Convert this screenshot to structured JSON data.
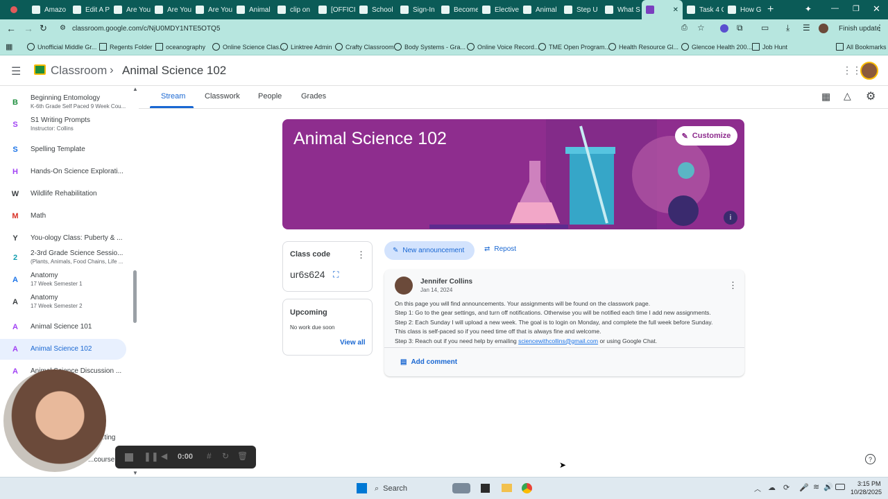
{
  "browser": {
    "tabs": [
      "Amazo",
      "Edit A P",
      "Are You",
      "Are You",
      "Are You",
      "Animal",
      "clip on",
      "[OFFICI",
      "School",
      "Sign-In",
      "Become",
      "Elective",
      "Animal",
      "Step U",
      "What S",
      "",
      "Task 4 C",
      "How G"
    ],
    "url": "classroom.google.com/c/NjU0MDY1NTE5OTQ5",
    "finish_update": "Finish update",
    "bookmarks": [
      "Unofficial Middle Gr...",
      "Regents Folder",
      "oceanography",
      "Online Science Clas...",
      "Linktree Admin",
      "Crafty Classroom",
      "Body Systems - Gra...",
      "Online Voice Record...",
      "TME Open Program...",
      "Health Resource Gl...",
      "Glencoe Health 200...",
      "Job Hunt",
      "All Bookmarks"
    ]
  },
  "app": {
    "brand": "Classroom",
    "breadcrumb_sep": "›",
    "course_title": "Animal Science 102"
  },
  "tabs": [
    "Stream",
    "Classwork",
    "People",
    "Grades"
  ],
  "sidebar": [
    {
      "letter": "B",
      "name": "Beginning Entomology",
      "sub": "K-6th Grade Self Paced 9 Week Cou...",
      "color": "#1e8e3e"
    },
    {
      "letter": "S",
      "name": "S1 Writing Prompts",
      "sub": "Instructor: Collins",
      "color": "#a142f4"
    },
    {
      "letter": "S",
      "name": "Spelling Template",
      "sub": "",
      "color": "#1a73e8"
    },
    {
      "letter": "H",
      "name": "Hands-On Science Explorati...",
      "sub": "",
      "color": "#a142f4"
    },
    {
      "letter": "W",
      "name": "Wildlife Rehabilitation",
      "sub": "",
      "color": "#3c4043"
    },
    {
      "letter": "M",
      "name": "Math",
      "sub": "",
      "color": "#d93025"
    },
    {
      "letter": "Y",
      "name": "You-ology Class: Puberty & ...",
      "sub": "",
      "color": "#3c4043"
    },
    {
      "letter": "2",
      "name": "2-3rd Grade Science Sessio...",
      "sub": "(Plants, Animals, Food Chains, Life ...",
      "color": "#129eaf"
    },
    {
      "letter": "A",
      "name": "Anatomy",
      "sub": "17 Week Semester 1",
      "color": "#1a73e8"
    },
    {
      "letter": "A",
      "name": "Anatomy",
      "sub": "17 Week Semester 2",
      "color": "#3c4043"
    },
    {
      "letter": "A",
      "name": "Animal Science 101",
      "sub": "",
      "color": "#a142f4"
    },
    {
      "letter": "A",
      "name": "Animal Science 102",
      "sub": "",
      "color": "#a142f4"
    },
    {
      "letter": "A",
      "name": "Animal Science Discussion ...",
      "sub": "",
      "color": "#a142f4"
    }
  ],
  "sidebar_partial": [
    "...ting",
    "...course"
  ],
  "banner": {
    "title": "Animal Science 102",
    "customize": "Customize"
  },
  "class_code": {
    "label": "Class code",
    "code": "ur6s624"
  },
  "upcoming": {
    "title": "Upcoming",
    "text": "No work due soon",
    "link": "View all"
  },
  "actions": {
    "new_announcement": "New announcement",
    "repost": "Repost"
  },
  "post": {
    "author": "Jennifer Collins",
    "date": "Jan 14, 2024",
    "lines": [
      "On this page you will find announcements. Your assignments will be found on the classwork page.",
      "Step 1: Go to the gear settings, and turn off notifications. Otherwise you will be notified each time I add new assignments.",
      "Step 2: Each Sunday I will upload a new week. The goal is to login on Monday, and complete the full week before Sunday.",
      "This class is self-paced so if you need time off that is always fine and welcome."
    ],
    "line5_pre": "Step 3: Reach out if you need help by emailing ",
    "email": "sciencewithcollins@gmail.com",
    "line5_post": " or using Google Chat.",
    "add_comment": "Add comment"
  },
  "recorder": {
    "time": "0:00"
  },
  "taskbar": {
    "search": "Search",
    "time": "3:15 PM",
    "date": "10/28/2025"
  },
  "colors": {
    "accent": "#1967d2",
    "banner": "#8e2d8e",
    "selected": "#e8f0fe",
    "tabbar": "#0b5b57",
    "toolbar": "#b7e6df"
  }
}
